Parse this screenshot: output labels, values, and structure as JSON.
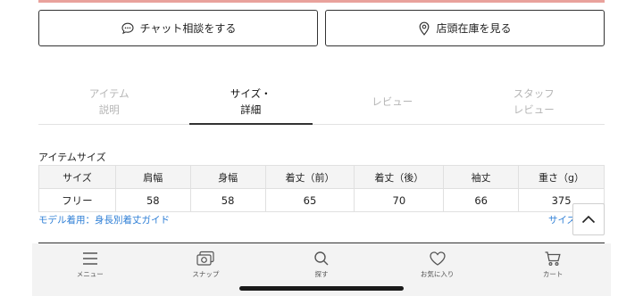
{
  "actions": {
    "chat_label": "チャット相談をする",
    "store_label": "店頭在庫を見る"
  },
  "tabs": [
    {
      "label": "アイテム\n説明",
      "active": false
    },
    {
      "label": "サイズ・\n詳細",
      "active": true
    },
    {
      "label": "レビュー",
      "active": false
    },
    {
      "label": "スタッフ\nレビュー",
      "active": false
    }
  ],
  "size": {
    "title": "アイテムサイズ",
    "headers": [
      "サイズ",
      "肩幅",
      "身幅",
      "着丈（前）",
      "着丈（後）",
      "袖丈",
      "重さ（g）"
    ],
    "rows": [
      [
        "フリー",
        "58",
        "58",
        "65",
        "70",
        "66",
        "375"
      ]
    ],
    "guide_link": "モデル着用：身長別着丈ガイド",
    "size_link": "サイズ"
  },
  "nav": [
    {
      "label": "メニュー",
      "icon": "menu-icon"
    },
    {
      "label": "スナップ",
      "icon": "snap-icon"
    },
    {
      "label": "探す",
      "icon": "search-icon"
    },
    {
      "label": "お気に入り",
      "icon": "heart-icon"
    },
    {
      "label": "カート",
      "icon": "cart-icon"
    }
  ]
}
